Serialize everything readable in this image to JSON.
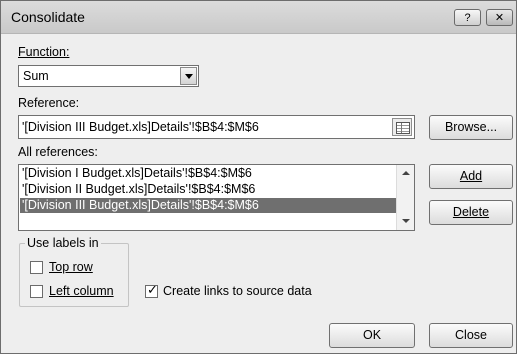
{
  "window": {
    "title": "Consolidate",
    "help_button": "?",
    "close_button": "✕"
  },
  "function": {
    "label": "Function:",
    "value": "Sum"
  },
  "reference": {
    "label": "Reference:",
    "value": "'[Division III Budget.xls]Details'!$B$4:$M$6",
    "browse_button": "Browse..."
  },
  "all_references": {
    "label": "All references:",
    "items": [
      "'[Division I Budget.xls]Details'!$B$4:$M$6",
      "'[Division II Budget.xls]Details'!$B$4:$M$6",
      "'[Division III Budget.xls]Details'!$B$4:$M$6"
    ],
    "selected_index": 2,
    "add_button": "Add",
    "delete_button": "Delete"
  },
  "use_labels": {
    "title": "Use labels in",
    "top_row": {
      "label": "Top row",
      "checked": false
    },
    "left_column": {
      "label": "Left column",
      "checked": false
    }
  },
  "create_links": {
    "label": "Create links to source data",
    "checked": true
  },
  "buttons": {
    "ok": "OK",
    "close": "Close"
  }
}
